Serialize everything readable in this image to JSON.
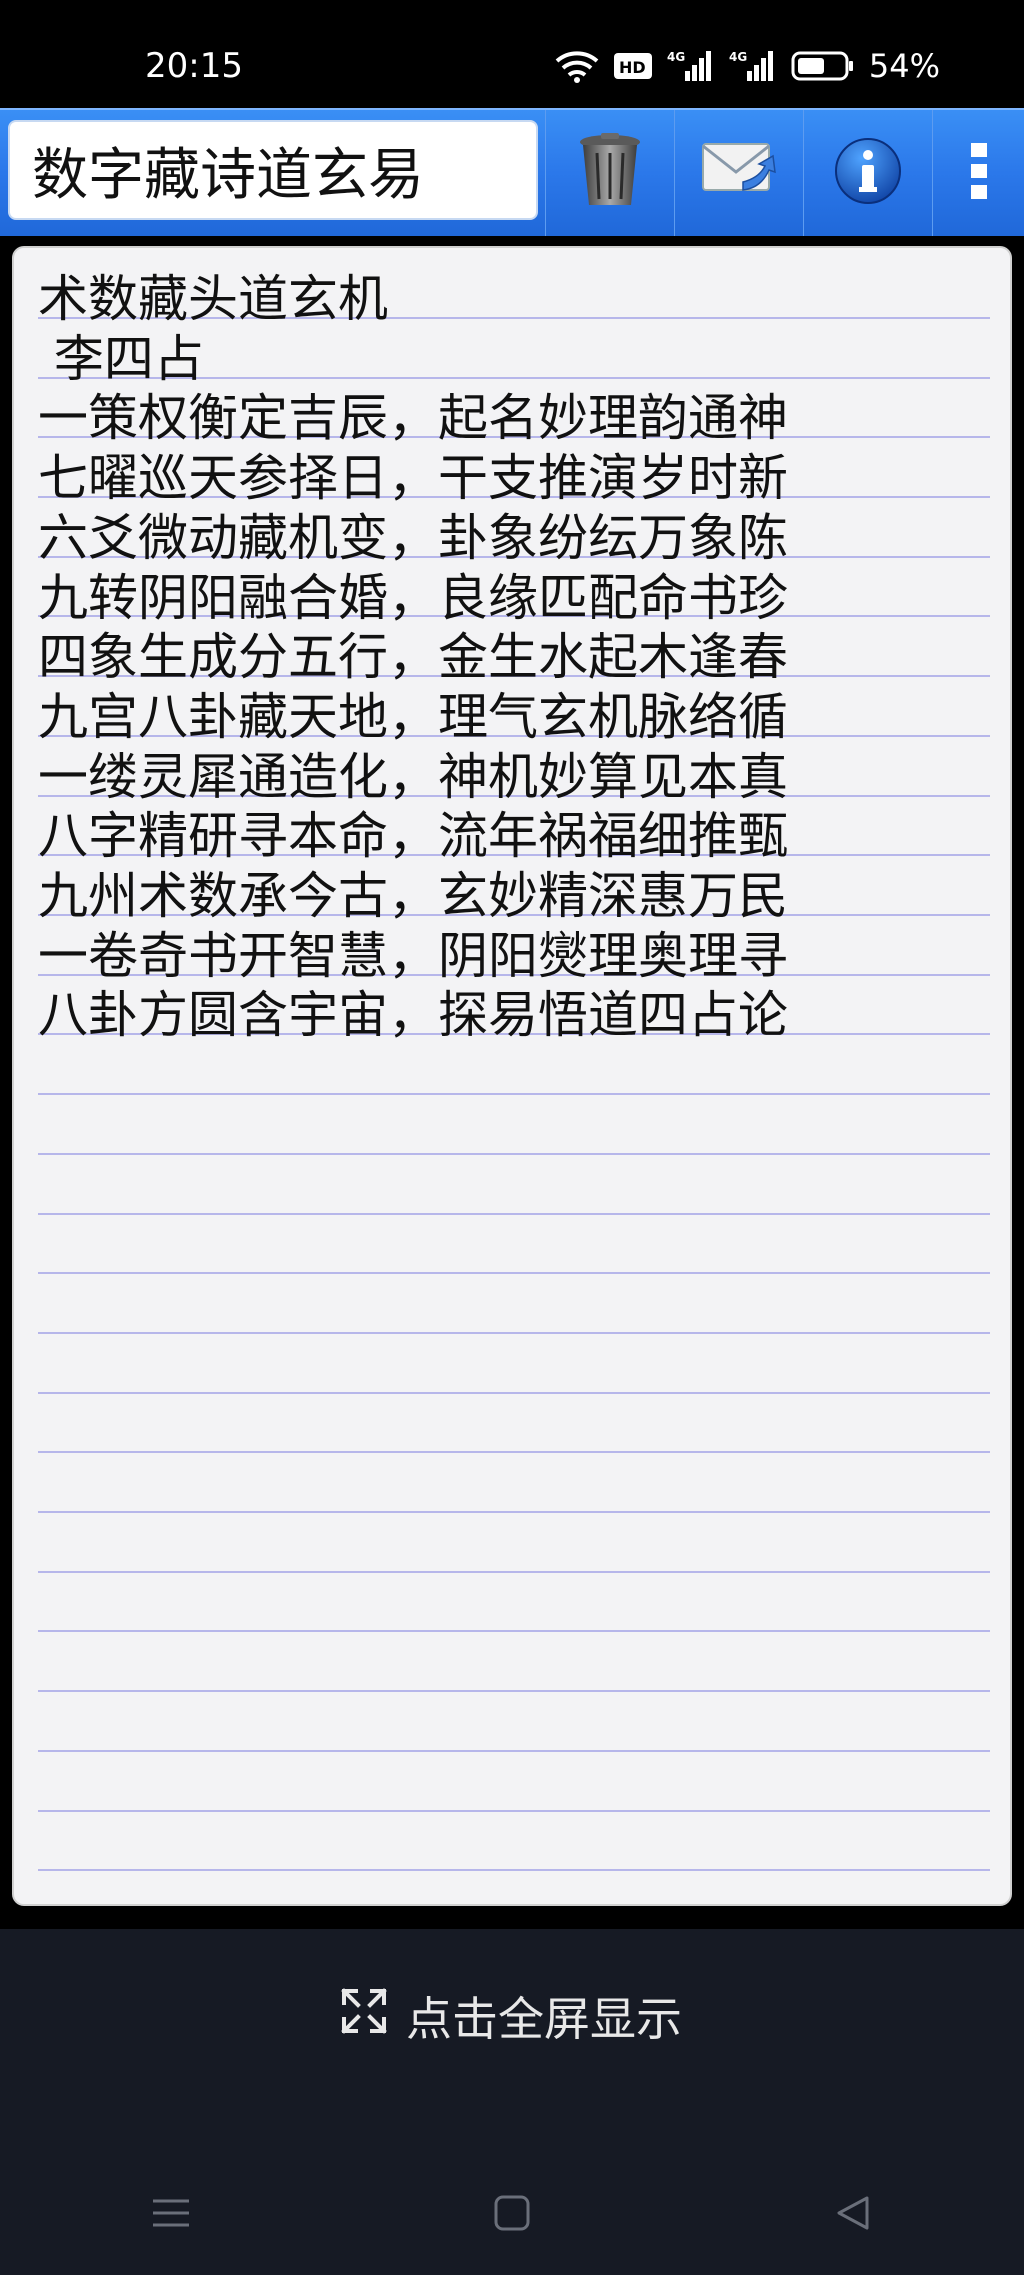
{
  "status_bar": {
    "time": "20:15",
    "battery_percent": "54%",
    "icons": [
      "wifi-icon",
      "hd-icon",
      "signal-4g-icon",
      "signal-4g-icon",
      "battery-icon"
    ]
  },
  "toolbar": {
    "title": "数字藏诗道玄易",
    "buttons": [
      "trash-icon",
      "mail-icon",
      "info-icon",
      "more-vert-icon"
    ]
  },
  "note": {
    "lines": [
      "术数藏头道玄机",
      " 李四占",
      "一策权衡定吉辰，起名妙理韵通神",
      "七曜巡天参择日，干支推演岁时新",
      "六爻微动藏机变，卦象纷纭万象陈",
      "九转阴阳融合婚，良缘匹配命书珍",
      "四象生成分五行，金生水起木逢春",
      "九宫八卦藏天地，理气玄机脉络循",
      "一缕灵犀通造化，神机妙算见本真",
      "八字精研寻本命，流年祸福细推甄",
      "九州术数承今古，玄妙精深惠万民",
      "一卷奇书开智慧，阴阳爕理奥理寻",
      "八卦方圆含宇宙，探易悟道四占论"
    ]
  },
  "bottom": {
    "fullscreen_label": "点击全屏显示"
  },
  "colors": {
    "toolbar_blue": "#2b78ea",
    "note_background": "#f3f3f5",
    "rule_line": "#b6b6ea",
    "bottom_panel": "#161a24"
  }
}
